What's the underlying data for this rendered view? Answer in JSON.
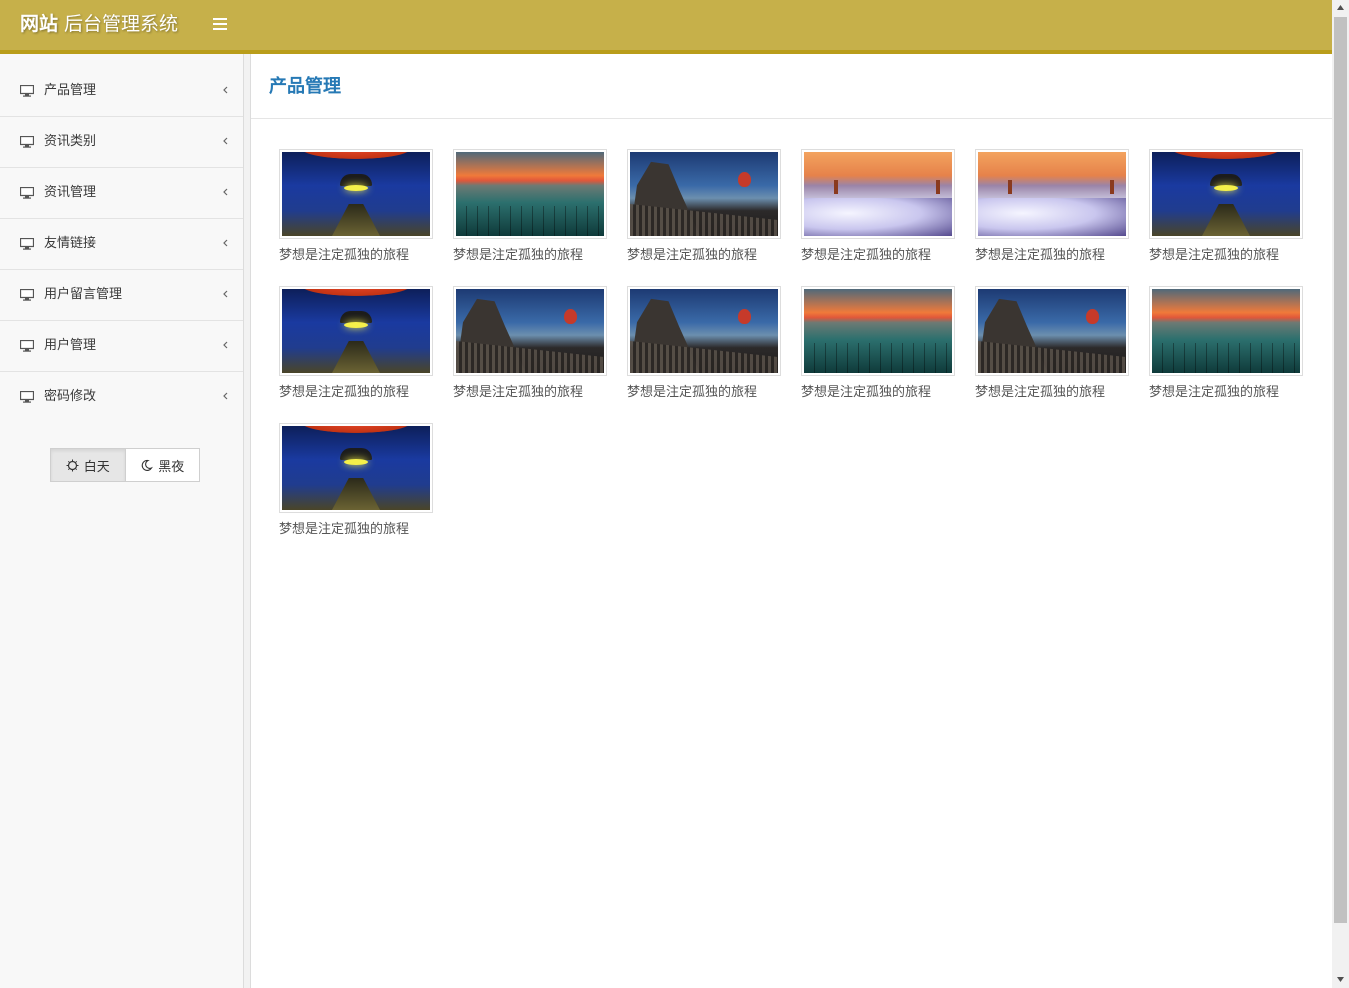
{
  "header": {
    "brand_bold": "网站",
    "brand_rest": " 后台管理系统"
  },
  "sidebar": {
    "items": [
      {
        "label": "产品管理",
        "icon": "desktop-icon"
      },
      {
        "label": "资讯类别",
        "icon": "desktop-icon"
      },
      {
        "label": "资讯管理",
        "icon": "desktop-icon"
      },
      {
        "label": "友情链接",
        "icon": "desktop-icon"
      },
      {
        "label": "用户留言管理",
        "icon": "desktop-icon"
      },
      {
        "label": "用户管理",
        "icon": "desktop-icon"
      },
      {
        "label": "密码修改",
        "icon": "desktop-icon"
      }
    ],
    "theme": {
      "day": "白天",
      "night": "黑夜",
      "active": "day"
    }
  },
  "main": {
    "title": "产品管理",
    "products": [
      {
        "caption": "梦想是注定孤独的旅程",
        "image": "tunnel"
      },
      {
        "caption": "梦想是注定孤独的旅程",
        "image": "lake"
      },
      {
        "caption": "梦想是注定孤独的旅程",
        "image": "city"
      },
      {
        "caption": "梦想是注定孤独的旅程",
        "image": "fog"
      },
      {
        "caption": "梦想是注定孤独的旅程",
        "image": "fog"
      },
      {
        "caption": "梦想是注定孤独的旅程",
        "image": "tunnel"
      },
      {
        "caption": "梦想是注定孤独的旅程",
        "image": "tunnel"
      },
      {
        "caption": "梦想是注定孤独的旅程",
        "image": "city"
      },
      {
        "caption": "梦想是注定孤独的旅程",
        "image": "city"
      },
      {
        "caption": "梦想是注定孤独的旅程",
        "image": "lake"
      },
      {
        "caption": "梦想是注定孤独的旅程",
        "image": "city"
      },
      {
        "caption": "梦想是注定孤独的旅程",
        "image": "lake"
      },
      {
        "caption": "梦想是注定孤独的旅程",
        "image": "tunnel"
      }
    ]
  },
  "colors": {
    "header_bg": "#c6b04a",
    "title_blue": "#2679b5"
  }
}
